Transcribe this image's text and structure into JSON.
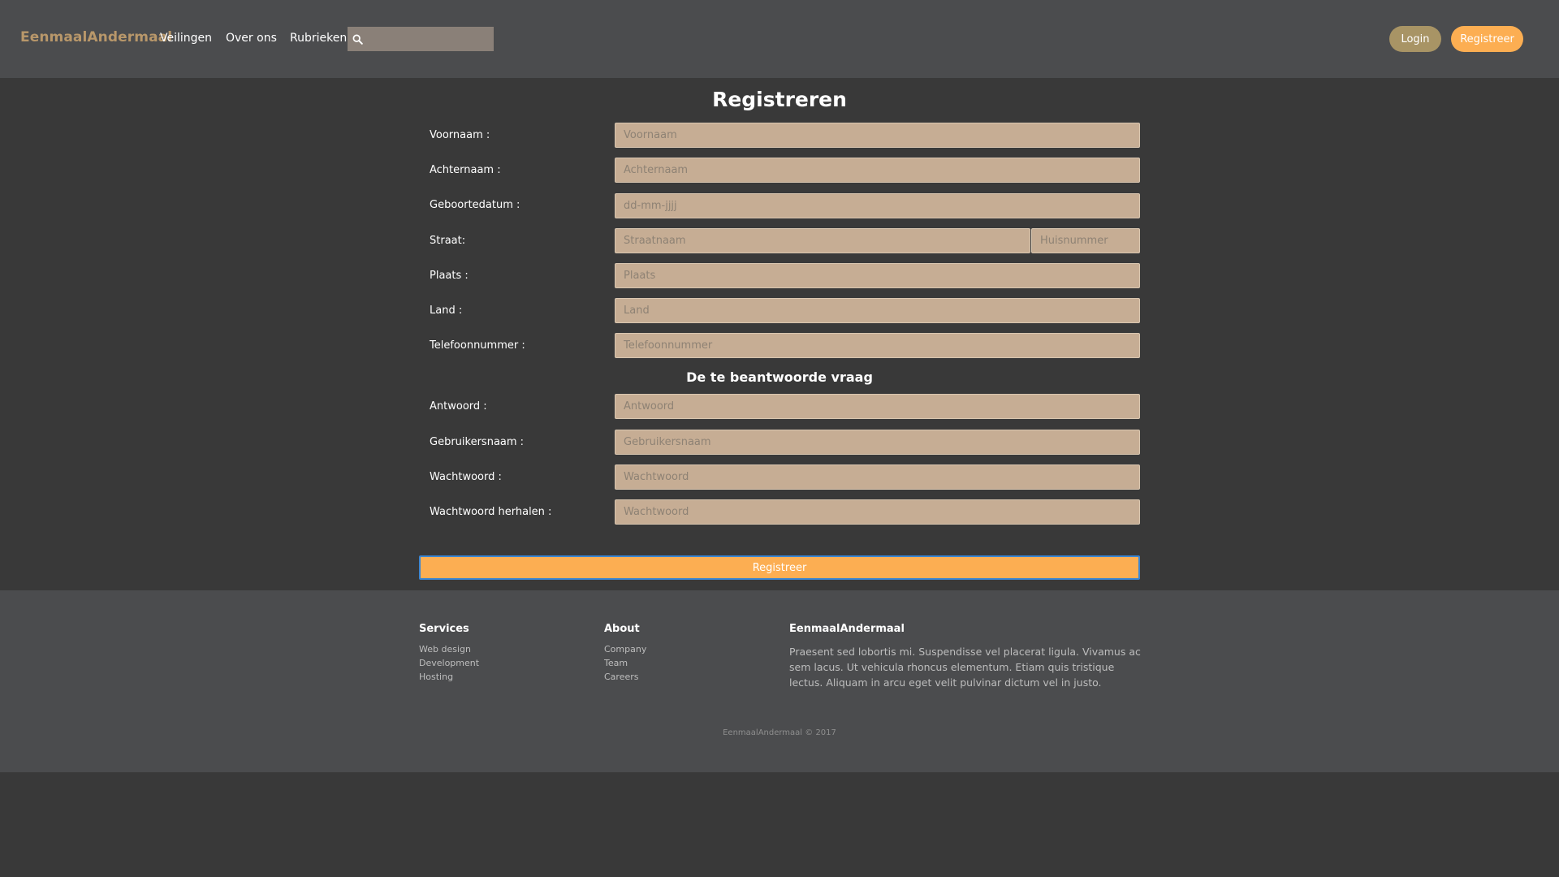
{
  "navbar": {
    "brand": "EenmaalAndermaal",
    "links": [
      "Veilingen",
      "Over ons",
      "Rubrieken"
    ],
    "search": {
      "placeholder": "",
      "value": "",
      "icon": "search-icon"
    },
    "login_label": "Login",
    "register_label": "Registreer",
    "colors": {
      "brand": "#b8976a",
      "login": "#a89465",
      "register": "#fcae52"
    }
  },
  "form": {
    "title": "Registreren",
    "fields": {
      "voornaam": {
        "label": "Voornaam :",
        "placeholder": "Voornaam"
      },
      "achternaam": {
        "label": "Achternaam :",
        "placeholder": "Achternaam"
      },
      "geboortedatum": {
        "label": "Geboortedatum :",
        "placeholder": "dd-mm-jjjj"
      },
      "straat": {
        "label": "Straat:",
        "placeholder": "Straatnaam",
        "house_placeholder": "Huisnummer"
      },
      "plaats": {
        "label": "Plaats :",
        "placeholder": "Plaats"
      },
      "land": {
        "label": "Land :",
        "placeholder": "Land"
      },
      "telefoon": {
        "label": "Telefoonnummer :",
        "placeholder": "Telefoonnummer"
      },
      "antwoord": {
        "label": "Antwoord :",
        "placeholder": "Antwoord"
      },
      "gebruikersnaam": {
        "label": "Gebruikersnaam :",
        "placeholder": "Gebruikersnaam"
      },
      "wachtwoord": {
        "label": "Wachtwoord :",
        "placeholder": "Wachtwoord"
      },
      "wachtwoord_herhalen": {
        "label": "Wachtwoord herhalen :",
        "placeholder": "Wachtwoord"
      }
    },
    "security_heading": "De te beantwoorde vraag",
    "submit_label": "Registreer",
    "colors": {
      "field_bg": "#c6ad94",
      "submit": "#fcae52",
      "submit_border": "#3b85d1"
    }
  },
  "footer": {
    "services": {
      "heading": "Services",
      "links": [
        "Web design",
        "Development",
        "Hosting"
      ]
    },
    "about": {
      "heading": "About",
      "links": [
        "Company",
        "Team",
        "Careers"
      ]
    },
    "company": {
      "heading": "EenmaalAndermaal",
      "text": "Praesent sed lobortis mi. Suspendisse vel placerat ligula. Vivamus ac sem lacus. Ut vehicula rhoncus elementum. Etiam quis tristique lectus. Aliquam in arcu eget velit pulvinar dictum vel in justo."
    },
    "copyright": "EenmaalAndermaal © 2017"
  }
}
